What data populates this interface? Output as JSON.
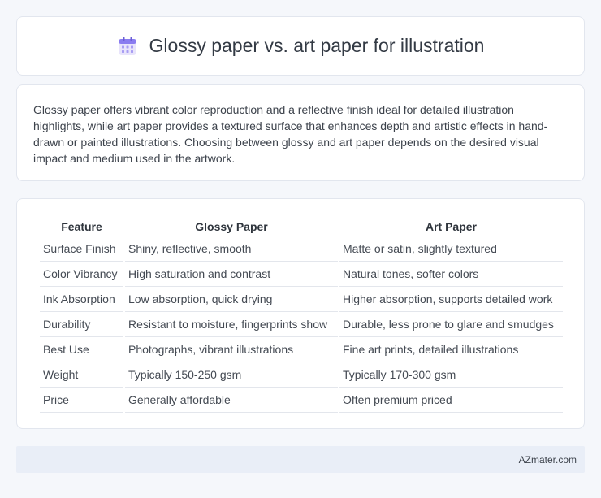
{
  "header": {
    "title": "Glossy paper vs. art paper for illustration",
    "icon": "calendar-icon"
  },
  "intro": {
    "text": "Glossy paper offers vibrant color reproduction and a reflective finish ideal for detailed illustration highlights, while art paper provides a textured surface that enhances depth and artistic effects in hand-drawn or painted illustrations. Choosing between glossy and art paper depends on the desired visual impact and medium used in the artwork."
  },
  "table": {
    "headers": [
      "Feature",
      "Glossy Paper",
      "Art Paper"
    ],
    "rows": [
      [
        "Surface Finish",
        "Shiny, reflective, smooth",
        "Matte or satin, slightly textured"
      ],
      [
        "Color Vibrancy",
        "High saturation and contrast",
        "Natural tones, softer colors"
      ],
      [
        "Ink Absorption",
        "Low absorption, quick drying",
        "Higher absorption, supports detailed work"
      ],
      [
        "Durability",
        "Resistant to moisture, fingerprints show",
        "Durable, less prone to glare and smudges"
      ],
      [
        "Best Use",
        "Photographs, vibrant illustrations",
        "Fine art prints, detailed illustrations"
      ],
      [
        "Weight",
        "Typically 150-250 gsm",
        "Typically 170-300 gsm"
      ],
      [
        "Price",
        "Generally affordable",
        "Often premium priced"
      ]
    ]
  },
  "footer": {
    "brand": "AZmater.com"
  },
  "colors": {
    "background": "#f5f7fb",
    "card": "#ffffff",
    "footer": "#e9eef7",
    "icon_accent": "#8a7cf0"
  }
}
